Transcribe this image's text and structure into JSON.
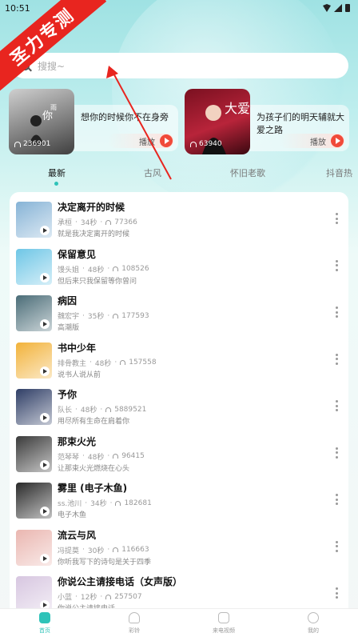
{
  "status": {
    "time": "10:51"
  },
  "watermark": "圣力专测",
  "search": {
    "placeholder": "搜搜~"
  },
  "banners": [
    {
      "count": "236901",
      "title": "想你的时候你不在身旁",
      "play_label": "播放",
      "cover_text": "你"
    },
    {
      "count": "63940",
      "title": "为孩子们的明天辅就大爱之路",
      "play_label": "播放",
      "cover_text": "大爱"
    }
  ],
  "tabs": [
    {
      "label": "最新",
      "active": true
    },
    {
      "label": "古风",
      "active": false
    },
    {
      "label": "怀旧老歌",
      "active": false
    },
    {
      "label": "抖音热",
      "active": false
    }
  ],
  "songs": [
    {
      "title": "决定离开的时候",
      "artist": "承桓",
      "duration": "34秒",
      "plays": "77366",
      "desc": "就是我决定离开的时候",
      "thumb_color": "#86b3d6"
    },
    {
      "title": "保留意见",
      "artist": "馒头姐",
      "duration": "48秒",
      "plays": "108526",
      "desc": "但后来只我保留等你曾问",
      "thumb_color": "#6ec6e6"
    },
    {
      "title": "病因",
      "artist": "魏宏宇",
      "duration": "35秒",
      "plays": "177593",
      "desc": "高潮版",
      "thumb_color": "#4a6c77"
    },
    {
      "title": "书中少年",
      "artist": "排骨教主",
      "duration": "48秒",
      "plays": "157558",
      "desc": "说书人说从前",
      "thumb_color": "#f2b23a"
    },
    {
      "title": "予你",
      "artist": "队长",
      "duration": "48秒",
      "plays": "5889521",
      "desc": "用尽所有生命在肩着你",
      "thumb_color": "#2f3e66"
    },
    {
      "title": "那束火光",
      "artist": "范琴琴",
      "duration": "48秒",
      "plays": "96415",
      "desc": "让那束火光燃烧在心头",
      "thumb_color": "#3a3a3a"
    },
    {
      "title": "雾里 (电子木鱼)",
      "artist": "ss.池川",
      "duration": "34秒",
      "plays": "182681",
      "desc": "电子木鱼",
      "thumb_color": "#2a2a2a"
    },
    {
      "title": "流云与风",
      "artist": "冯提莫",
      "duration": "30秒",
      "plays": "116663",
      "desc": "你听我写下的诗句是关于四季",
      "thumb_color": "#eab6b0"
    },
    {
      "title": "你说公主请接电话（女声版）",
      "artist": "小蓝",
      "duration": "12秒",
      "plays": "257507",
      "desc": "你说公主请接电话",
      "thumb_color": "#d7c6e0"
    }
  ],
  "nav": [
    {
      "label": "首页",
      "active": true
    },
    {
      "label": "彩铃",
      "active": false
    },
    {
      "label": "来电视频",
      "active": false
    },
    {
      "label": "我的",
      "active": false
    }
  ]
}
